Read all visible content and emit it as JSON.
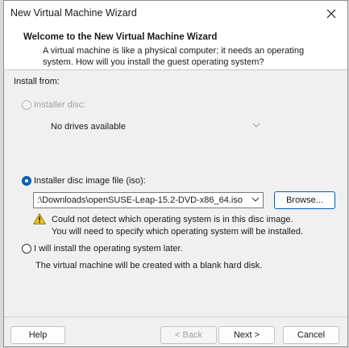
{
  "window": {
    "title": "New Virtual Machine Wizard"
  },
  "header": {
    "title": "Welcome to the New Virtual Machine Wizard",
    "description_line1": "A virtual machine is like a physical computer; it needs an operating",
    "description_line2": "system. How will you install the guest operating system?"
  },
  "install": {
    "section_label": "Install from:",
    "disc_option": {
      "label": "Installer disc:",
      "selected": false,
      "enabled": false,
      "drive_value": "No drives available"
    },
    "iso_option": {
      "label": "Installer disc image file (iso):",
      "selected": true,
      "path_value": ":\\Downloads\\openSUSE-Leap-15.2-DVD-x86_64.iso",
      "browse_label": "Browse...",
      "warning_line1": "Could not detect which operating system is in this disc image.",
      "warning_line2": "You will need to specify which operating system will be installed."
    },
    "later_option": {
      "label": "I will install the operating system later.",
      "selected": false,
      "description": "The virtual machine will be created with a blank hard disk."
    }
  },
  "footer": {
    "help_label": "Help",
    "back_label": "< Back",
    "next_label": "Next >",
    "cancel_label": "Cancel"
  },
  "colors": {
    "accent": "#005fb8",
    "warning": "#f2c811"
  }
}
